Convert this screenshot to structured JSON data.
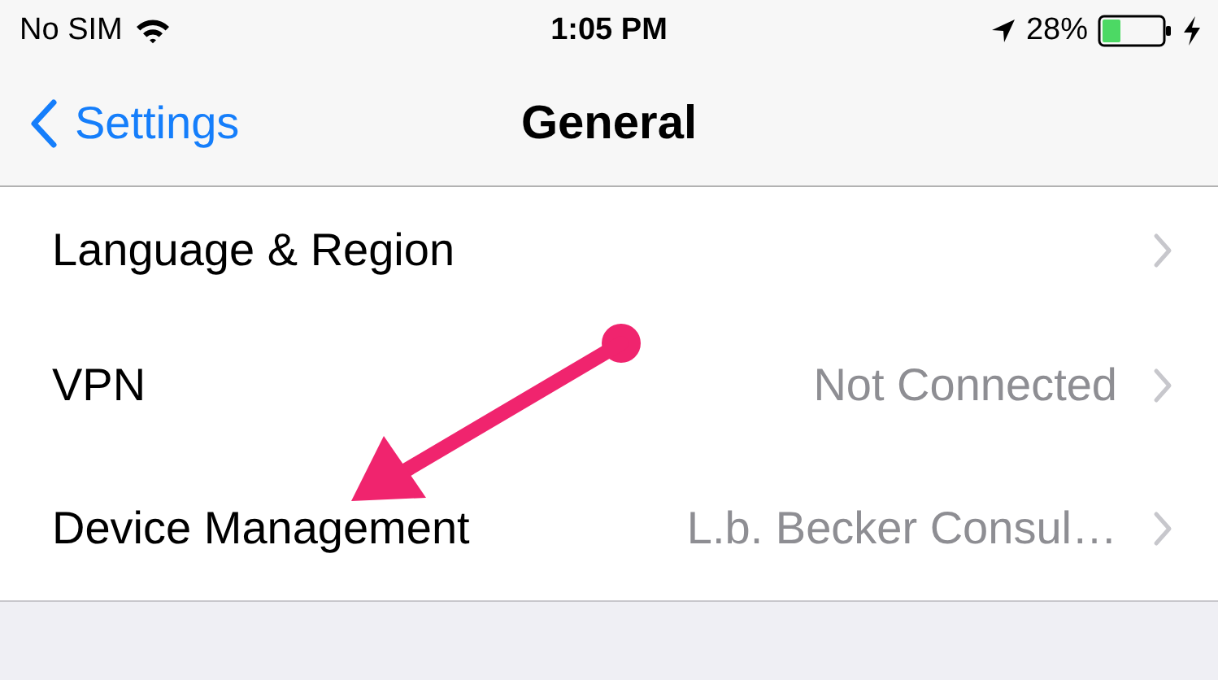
{
  "status_bar": {
    "carrier": "No SIM",
    "time": "1:05 PM",
    "battery": "28%"
  },
  "nav": {
    "back": "Settings",
    "title": "General"
  },
  "rows": [
    {
      "label": "Language & Region"
    },
    {
      "label": "VPN",
      "value": "Not Connected"
    },
    {
      "label": "Device Management",
      "value": "L.b. Becker Consul…"
    }
  ]
}
